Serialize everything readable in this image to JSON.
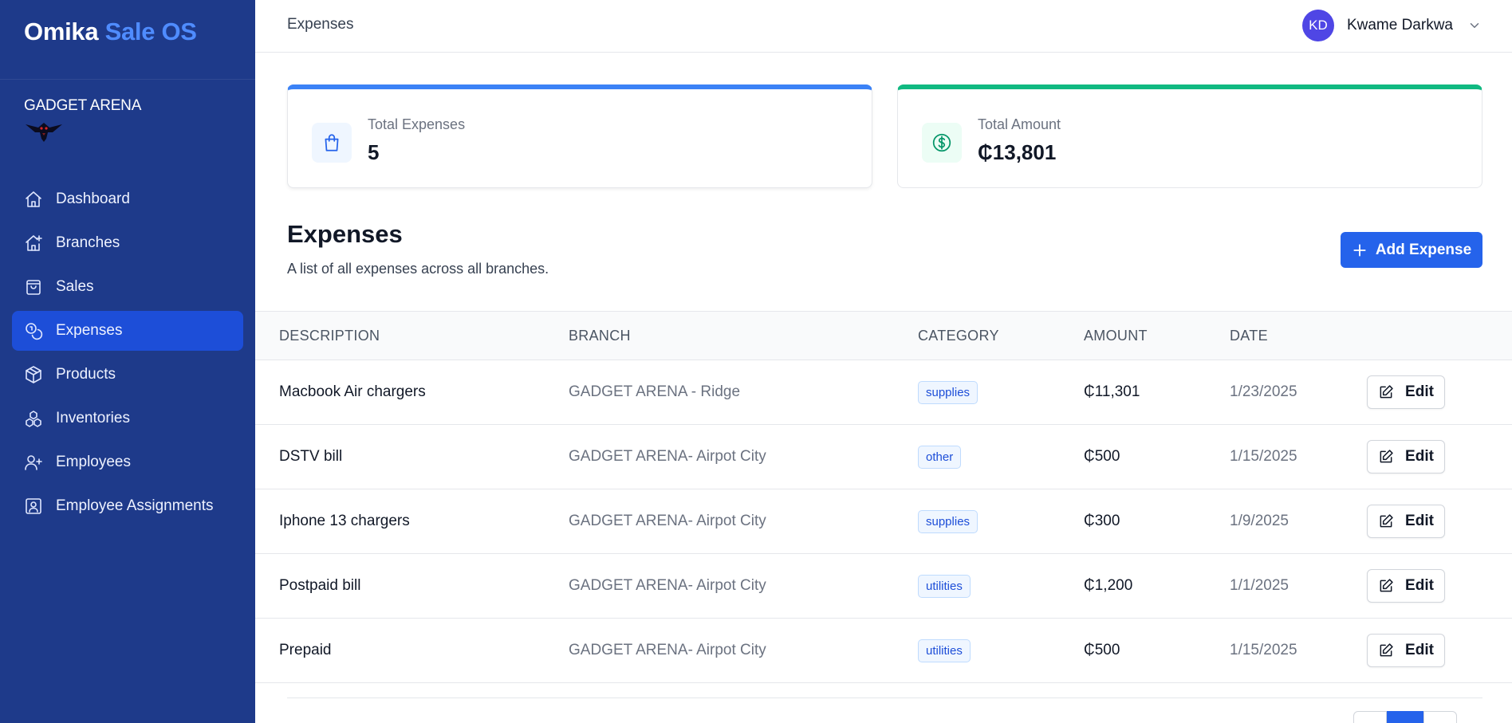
{
  "app": {
    "name_part1": "Omika",
    "name_part2": "Sale OS"
  },
  "organization": {
    "name": "GADGET ARENA"
  },
  "sidebar": {
    "items": [
      {
        "label": "Dashboard",
        "icon": "home-icon",
        "active": false
      },
      {
        "label": "Branches",
        "icon": "branch-icon",
        "active": false
      },
      {
        "label": "Sales",
        "icon": "shopping-bag-icon",
        "active": false
      },
      {
        "label": "Expenses",
        "icon": "coins-icon",
        "active": true
      },
      {
        "label": "Products",
        "icon": "box-icon",
        "active": false
      },
      {
        "label": "Inventories",
        "icon": "boxes-icon",
        "active": false
      },
      {
        "label": "Employees",
        "icon": "user-plus-icon",
        "active": false
      },
      {
        "label": "Employee Assignments",
        "icon": "id-card-icon",
        "active": false
      }
    ]
  },
  "header": {
    "breadcrumb": "Expenses",
    "user": {
      "initials": "KD",
      "name": "Kwame Darkwa"
    }
  },
  "stats": {
    "total_expenses": {
      "label": "Total Expenses",
      "value": "5",
      "icon": "shopping-bag-icon",
      "accent": "#3b82f6"
    },
    "total_amount": {
      "label": "Total Amount",
      "value": "₵13,801",
      "icon": "dollar-circle-icon",
      "accent": "#10b981"
    }
  },
  "section": {
    "title": "Expenses",
    "subtitle": "A list of all expenses across all branches.",
    "add_button": "Add Expense"
  },
  "table": {
    "columns": [
      "DESCRIPTION",
      "BRANCH",
      "CATEGORY",
      "AMOUNT",
      "DATE"
    ],
    "edit_label": "Edit",
    "rows": [
      {
        "description": "Macbook Air chargers",
        "branch": "GADGET ARENA - Ridge",
        "category": "supplies",
        "amount": "₵11,301",
        "date": "1/23/2025"
      },
      {
        "description": "DSTV bill",
        "branch": "GADGET ARENA- Airpot City",
        "category": "other",
        "amount": "₵500",
        "date": "1/15/2025"
      },
      {
        "description": "Iphone 13 chargers",
        "branch": "GADGET ARENA- Airpot City",
        "category": "supplies",
        "amount": "₵300",
        "date": "1/9/2025"
      },
      {
        "description": "Postpaid bill",
        "branch": "GADGET ARENA- Airpot City",
        "category": "utilities",
        "amount": "₵1,200",
        "date": "1/1/2025"
      },
      {
        "description": "Prepaid",
        "branch": "GADGET ARENA- Airpot City",
        "category": "utilities",
        "amount": "₵500",
        "date": "1/15/2025"
      }
    ]
  },
  "colors": {
    "sidebar_bg": "#1e3a8a",
    "sidebar_active": "#1d4ed8",
    "primary": "#2563eb",
    "brand_accent": "#4f8cff",
    "avatar": "#4f46e5"
  }
}
